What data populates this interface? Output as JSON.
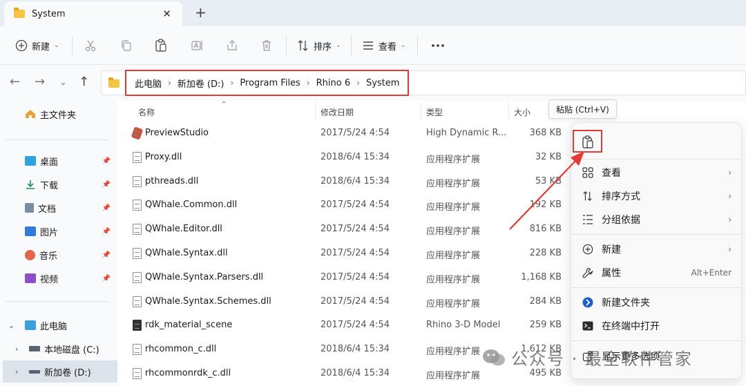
{
  "tab": {
    "title": "System"
  },
  "toolbar": {
    "new_label": "新建",
    "sort_label": "排序",
    "view_label": "查看"
  },
  "breadcrumb": [
    "此电脑",
    "新加卷 (D:)",
    "Program Files",
    "Rhino 6",
    "System"
  ],
  "sidebar": {
    "home": "主文件夹",
    "pinned": [
      "桌面",
      "下载",
      "文档",
      "图片",
      "音乐",
      "视频"
    ],
    "this_pc": "此电脑",
    "drives": [
      "本地磁盘 (C:)",
      "新加卷 (D:)"
    ]
  },
  "columns": {
    "name": "名称",
    "date": "修改日期",
    "type": "类型",
    "size": "大小"
  },
  "files": [
    {
      "name": "PreviewStudio",
      "date": "2017/5/24 4:54",
      "type": "High Dynamic R...",
      "size": "368 KB"
    },
    {
      "name": "Proxy.dll",
      "date": "2018/6/4 15:34",
      "type": "应用程序扩展",
      "size": "32 KB"
    },
    {
      "name": "pthreads.dll",
      "date": "2018/6/4 15:34",
      "type": "应用程序扩展",
      "size": "53 KB"
    },
    {
      "name": "QWhale.Common.dll",
      "date": "2017/5/24 4:54",
      "type": "应用程序扩展",
      "size": "192 KB"
    },
    {
      "name": "QWhale.Editor.dll",
      "date": "2017/5/24 4:54",
      "type": "应用程序扩展",
      "size": "816 KB"
    },
    {
      "name": "QWhale.Syntax.dll",
      "date": "2017/5/24 4:54",
      "type": "应用程序扩展",
      "size": "228 KB"
    },
    {
      "name": "QWhale.Syntax.Parsers.dll",
      "date": "2017/5/24 4:54",
      "type": "应用程序扩展",
      "size": "1,168 KB"
    },
    {
      "name": "QWhale.Syntax.Schemes.dll",
      "date": "2017/5/24 4:54",
      "type": "应用程序扩展",
      "size": "284 KB"
    },
    {
      "name": "rdk_material_scene",
      "date": "2017/5/24 4:54",
      "type": "Rhino 3-D Model",
      "size": "259 KB"
    },
    {
      "name": "rhcommon_c.dll",
      "date": "2018/6/4 15:34",
      "type": "应用程序扩展",
      "size": "1,612 KB"
    },
    {
      "name": "rhcommonrdk_c.dll",
      "date": "2018/6/4 15:34",
      "type": "应用程序扩展",
      "size": "495 KB"
    }
  ],
  "tooltip": "粘贴 (Ctrl+V)",
  "menu": {
    "view": "查看",
    "sort": "排序方式",
    "group": "分组依据",
    "new": "新建",
    "properties": "属性",
    "properties_shortcut": "Alt+Enter",
    "new_folder": "新建文件夹",
    "open_terminal": "在终端中打开",
    "more_options": "显示更多选项"
  },
  "watermark": "公众号 · 最全软件管家",
  "colors": {
    "highlight_red": "#e53935",
    "folder_yellow": "#f4c542"
  }
}
